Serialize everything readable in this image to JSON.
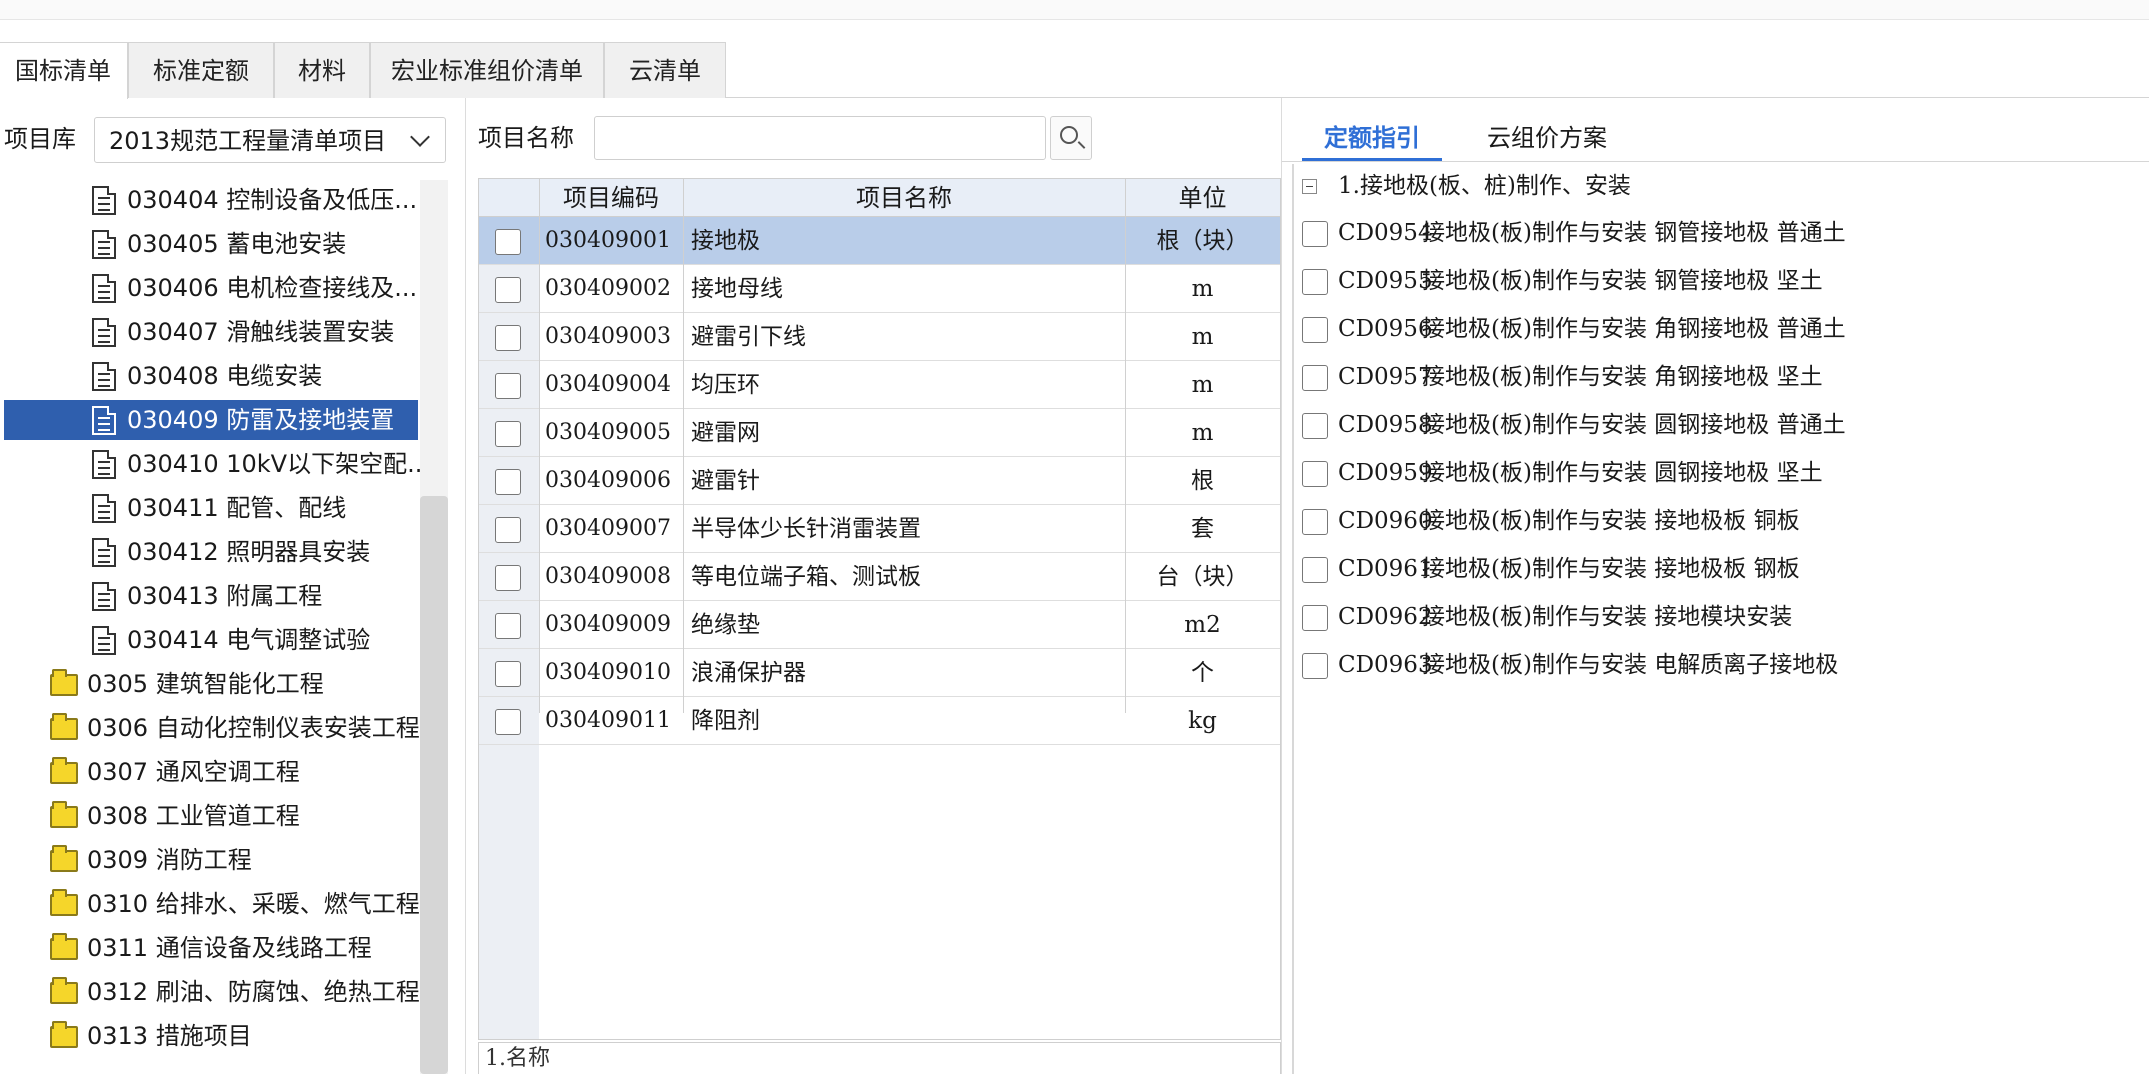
{
  "tabs": [
    "国标清单",
    "标准定额",
    "材料",
    "宏业标准组价清单",
    "云清单"
  ],
  "left": {
    "library_label": "项目库",
    "library_value": "2013规范工程量清单项目",
    "tree": [
      {
        "label": "030404 控制设备及低压...",
        "type": "doc",
        "selected": false
      },
      {
        "label": "030405 蓄电池安装",
        "type": "doc",
        "selected": false
      },
      {
        "label": "030406 电机检查接线及...",
        "type": "doc",
        "selected": false
      },
      {
        "label": "030407 滑触线装置安装",
        "type": "doc",
        "selected": false
      },
      {
        "label": "030408 电缆安装",
        "type": "doc",
        "selected": false
      },
      {
        "label": "030409 防雷及接地装置",
        "type": "doc",
        "selected": true
      },
      {
        "label": "030410 10kV以下架空配...",
        "type": "doc",
        "selected": false
      },
      {
        "label": "030411 配管、配线",
        "type": "doc",
        "selected": false
      },
      {
        "label": "030412 照明器具安装",
        "type": "doc",
        "selected": false
      },
      {
        "label": "030413 附属工程",
        "type": "doc",
        "selected": false
      },
      {
        "label": "030414 电气调整试验",
        "type": "doc",
        "selected": false
      },
      {
        "label": "0305 建筑智能化工程",
        "type": "folder",
        "selected": false
      },
      {
        "label": "0306 自动化控制仪表安装工程",
        "type": "folder",
        "selected": false
      },
      {
        "label": "0307 通风空调工程",
        "type": "folder",
        "selected": false
      },
      {
        "label": "0308 工业管道工程",
        "type": "folder",
        "selected": false
      },
      {
        "label": "0309 消防工程",
        "type": "folder",
        "selected": false
      },
      {
        "label": "0310 给排水、采暖、燃气工程",
        "type": "folder",
        "selected": false
      },
      {
        "label": "0311 通信设备及线路工程",
        "type": "folder",
        "selected": false
      },
      {
        "label": "0312 刷油、防腐蚀、绝热工程",
        "type": "folder",
        "selected": false
      },
      {
        "label": "0313 措施项目",
        "type": "folder",
        "selected": false
      }
    ]
  },
  "middle": {
    "name_label": "项目名称",
    "name_value": "",
    "columns": [
      "项目编码",
      "项目名称",
      "单位"
    ],
    "rows": [
      {
        "code": "030409001",
        "name": "接地极",
        "unit": "根（块）",
        "selected": true
      },
      {
        "code": "030409002",
        "name": "接地母线",
        "unit": "m",
        "selected": false
      },
      {
        "code": "030409003",
        "name": "避雷引下线",
        "unit": "m",
        "selected": false
      },
      {
        "code": "030409004",
        "name": "均压环",
        "unit": "m",
        "selected": false
      },
      {
        "code": "030409005",
        "name": "避雷网",
        "unit": "m",
        "selected": false
      },
      {
        "code": "030409006",
        "name": "避雷针",
        "unit": "根",
        "selected": false
      },
      {
        "code": "030409007",
        "name": "半导体少长针消雷装置",
        "unit": "套",
        "selected": false
      },
      {
        "code": "030409008",
        "name": "等电位端子箱、测试板",
        "unit": "台（块）",
        "selected": false
      },
      {
        "code": "030409009",
        "name": "绝缘垫",
        "unit": "m2",
        "selected": false
      },
      {
        "code": "030409010",
        "name": "浪涌保护器",
        "unit": "个",
        "selected": false
      },
      {
        "code": "030409011",
        "name": "降阻剂",
        "unit": "kg",
        "selected": false
      }
    ],
    "description": "1.名称"
  },
  "right": {
    "tabs": [
      "定额指引",
      "云组价方案"
    ],
    "group_label": "1.接地极(板、桩)制作、安装",
    "items": [
      {
        "code": "CD0954",
        "desc": "接地极(板)制作与安装 钢管接地极 普通土"
      },
      {
        "code": "CD0955",
        "desc": "接地极(板)制作与安装 钢管接地极 坚土"
      },
      {
        "code": "CD0956",
        "desc": "接地极(板)制作与安装 角钢接地极 普通土"
      },
      {
        "code": "CD0957",
        "desc": "接地极(板)制作与安装 角钢接地极 坚土"
      },
      {
        "code": "CD0958",
        "desc": "接地极(板)制作与安装 圆钢接地极 普通土"
      },
      {
        "code": "CD0959",
        "desc": "接地极(板)制作与安装 圆钢接地极 坚土"
      },
      {
        "code": "CD0960",
        "desc": "接地极(板)制作与安装 接地极板 铜板"
      },
      {
        "code": "CD0961",
        "desc": "接地极(板)制作与安装 接地极板 钢板"
      },
      {
        "code": "CD0962",
        "desc": "接地极(板)制作与安装 接地模块安装"
      },
      {
        "code": "CD0963",
        "desc": "接地极(板)制作与安装 电解质离子接地极"
      }
    ]
  },
  "colors": {
    "selected_tree": "#2f5fae",
    "selected_row": "#b9cde9",
    "active_tab": "#2f6fd6",
    "folder": "#f5d62a"
  }
}
